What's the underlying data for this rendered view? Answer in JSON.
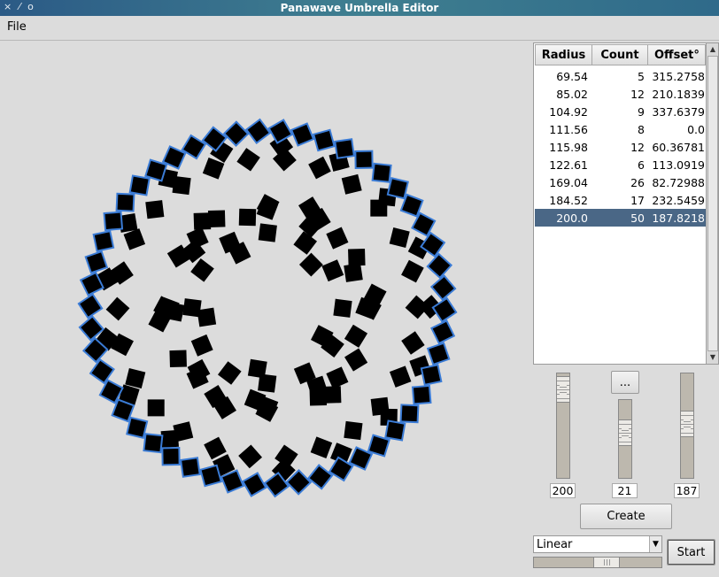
{
  "window": {
    "title": "Panawave Umbrella Editor",
    "titlebar_icons": [
      "close-icon",
      "pin-icon",
      "minimize-icon"
    ]
  },
  "menu": {
    "file_label": "File"
  },
  "table": {
    "headers": [
      "Radius",
      "Count",
      "Offset°"
    ],
    "rows": [
      {
        "radius": "69.54",
        "count": "5",
        "offset": "315.2758"
      },
      {
        "radius": "85.02",
        "count": "12",
        "offset": "210.1839"
      },
      {
        "radius": "104.92",
        "count": "9",
        "offset": "337.6379"
      },
      {
        "radius": "111.56",
        "count": "8",
        "offset": "0.0"
      },
      {
        "radius": "115.98",
        "count": "12",
        "offset": "60.36781"
      },
      {
        "radius": "122.61",
        "count": "6",
        "offset": "113.0919"
      },
      {
        "radius": "169.04",
        "count": "26",
        "offset": "82.72988"
      },
      {
        "radius": "184.52",
        "count": "17",
        "offset": "232.5459"
      },
      {
        "radius": "200.0",
        "count": "50",
        "offset": "187.8218"
      }
    ],
    "selected_index": 8
  },
  "controls": {
    "radius_value": "200",
    "count_value": "21",
    "offset_value": "187",
    "radius_level": 0.97,
    "count_level": 0.62,
    "offset_level": 0.52,
    "more_button_label": "...",
    "create_button_label": "Create",
    "start_button_label": "Start",
    "easing_selected": "Linear",
    "speed_level": 0.59
  },
  "canvas": {
    "background": "#dcdcdc",
    "square_fill": "#000000",
    "highlight_color": "#3a7bd5"
  }
}
